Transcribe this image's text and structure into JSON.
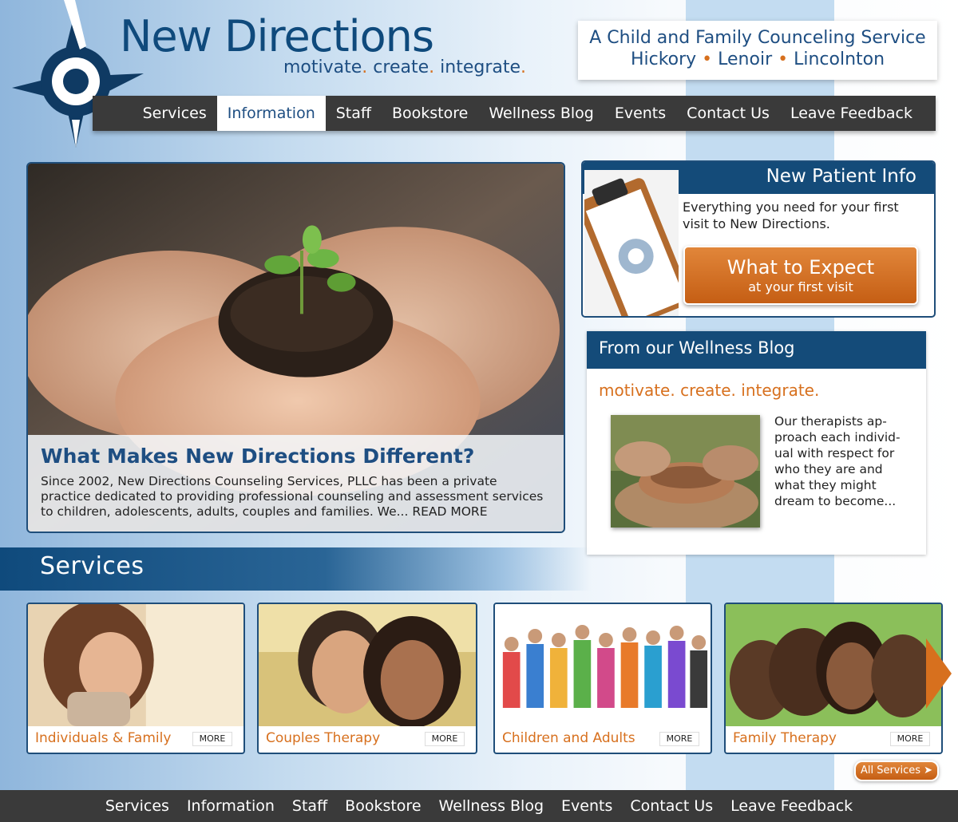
{
  "brand": {
    "title": "New Directions",
    "tagline_words": [
      "motivate",
      "create",
      "integrate"
    ],
    "tagline_sep": "."
  },
  "service_box": {
    "line1": "A Child and Family Counceling Service",
    "locations": [
      "Hickory",
      "Lenoir",
      "Lincolnton"
    ],
    "bullet": "•"
  },
  "nav": {
    "items": [
      "Services",
      "Information",
      "Staff",
      "Bookstore",
      "Wellness Blog",
      "Events",
      "Contact Us",
      "Leave Feedback"
    ],
    "active": "Information"
  },
  "hero": {
    "title": "What Makes New Directions Different?",
    "text": "Since 2002, New Directions Counseling Services, PLLC has been a private practice dedicated to providing professional counseling and assessment services to children, adolescents, adults, couples and families. We... READ MORE"
  },
  "new_patient": {
    "heading": "New Patient Info",
    "blurb": "Everything you need for your first visit to New Directions.",
    "button_main": "What to Expect",
    "button_sub": "at your first visit"
  },
  "blog": {
    "heading": "From our Wellness Blog",
    "tagline": "motivate. create. integrate.",
    "excerpt": "Our therapists ap-proach each individ-ual with respect for who they are and what they might dream to become..."
  },
  "services": {
    "title": "Services",
    "cards": [
      {
        "label": "Individuals & Family",
        "more": "MORE"
      },
      {
        "label": "Couples Therapy",
        "more": "MORE"
      },
      {
        "label": "Children and Adults",
        "more": "MORE"
      },
      {
        "label": "Family Therapy",
        "more": "MORE"
      }
    ],
    "all_label": "All Services ➤"
  },
  "colors": {
    "navy": "#144b79",
    "orange": "#d7701e",
    "nav_bg": "#3a3a3a"
  }
}
